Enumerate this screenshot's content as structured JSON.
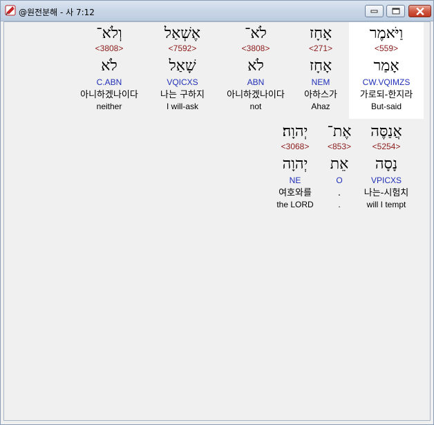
{
  "window": {
    "title": "@원전분해 - 사 7:12"
  },
  "rows": [
    {
      "words": [
        {
          "hebrew": "וַיֹּאמֶר",
          "strong": "<559>",
          "lemma": "אָמַר",
          "morph": "CW.VQIMZS",
          "korean": "가로되-한지라",
          "english": "But-said"
        },
        {
          "hebrew": "אָחָז",
          "strong": "<271>",
          "lemma": "אָחָז",
          "morph": "NEM",
          "korean": "아하스가",
          "english": "Ahaz"
        },
        {
          "hebrew": "לֹא־",
          "strong": "<3808>",
          "lemma": "לֹא",
          "morph": "ABN",
          "korean": "아니하겠나이다",
          "english": "not"
        },
        {
          "hebrew": "אֶשְׁאַל",
          "strong": "<7592>",
          "lemma": "שָׁאַל",
          "morph": "VQICXS",
          "korean": "나는 구하지",
          "english": "I will-ask"
        },
        {
          "hebrew": "וְלֹא־",
          "strong": "<3808>",
          "lemma": "לֹא",
          "morph": "C.ABN",
          "korean": "아니하겠나이다",
          "english": "neither"
        }
      ]
    },
    {
      "words": [
        {
          "hebrew": "אֲנַסֶּה",
          "strong": "<5254>",
          "lemma": "נָסָה",
          "morph": "VPICXS",
          "korean": "나는-시험치",
          "english": "will I tempt"
        },
        {
          "hebrew": "אֶת־",
          "strong": "<853>",
          "lemma": "אֵת",
          "morph": "O",
          "korean": ".",
          "english": "."
        },
        {
          "hebrew": "יְהוָה׃",
          "strong": "<3068>",
          "lemma": "יְהוָה",
          "morph": "NE",
          "korean": "여호와를",
          "english": "the LORD"
        }
      ]
    }
  ]
}
